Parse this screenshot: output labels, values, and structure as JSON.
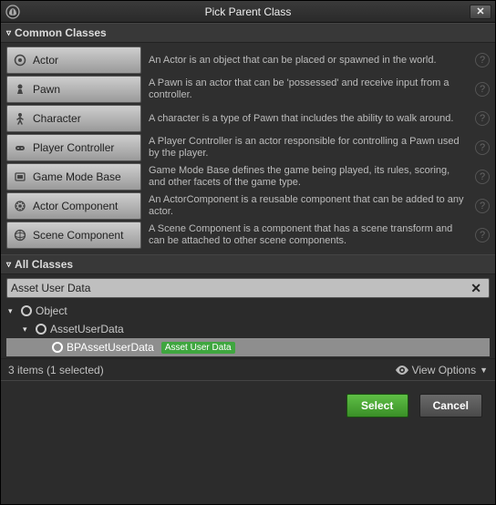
{
  "dialog": {
    "title": "Pick Parent Class"
  },
  "sections": {
    "common": "Common Classes",
    "all": "All Classes"
  },
  "common": [
    {
      "key": "actor",
      "label": "Actor",
      "desc": "An Actor is an object that can be placed or spawned in the world."
    },
    {
      "key": "pawn",
      "label": "Pawn",
      "desc": "A Pawn is an actor that can be 'possessed' and receive input from a controller."
    },
    {
      "key": "character",
      "label": "Character",
      "desc": "A character is a type of Pawn that includes the ability to walk around."
    },
    {
      "key": "playercontroller",
      "label": "Player Controller",
      "desc": "A Player Controller is an actor responsible for controlling a Pawn used by the player."
    },
    {
      "key": "gamemodebase",
      "label": "Game Mode Base",
      "desc": "Game Mode Base defines the game being played, its rules, scoring, and other facets of the game type."
    },
    {
      "key": "actorcomponent",
      "label": "Actor Component",
      "desc": "An ActorComponent is a reusable component that can be added to any actor."
    },
    {
      "key": "scenecomponent",
      "label": "Scene Component",
      "desc": "A Scene Component is a component that has a scene transform and can be attached to other scene components."
    }
  ],
  "search": {
    "value": "Asset User Data"
  },
  "tree": {
    "rows": [
      {
        "indent": 0,
        "expander": "▾",
        "label": "Object"
      },
      {
        "indent": 1,
        "expander": "▾",
        "label": "AssetUserData"
      },
      {
        "indent": 2,
        "expander": "",
        "label": "BPAssetUserData",
        "native": "Asset User Data",
        "selected": true
      }
    ]
  },
  "status": {
    "text": "3 items (1 selected)",
    "viewopts": "View Options"
  },
  "footer": {
    "select": "Select",
    "cancel": "Cancel"
  }
}
